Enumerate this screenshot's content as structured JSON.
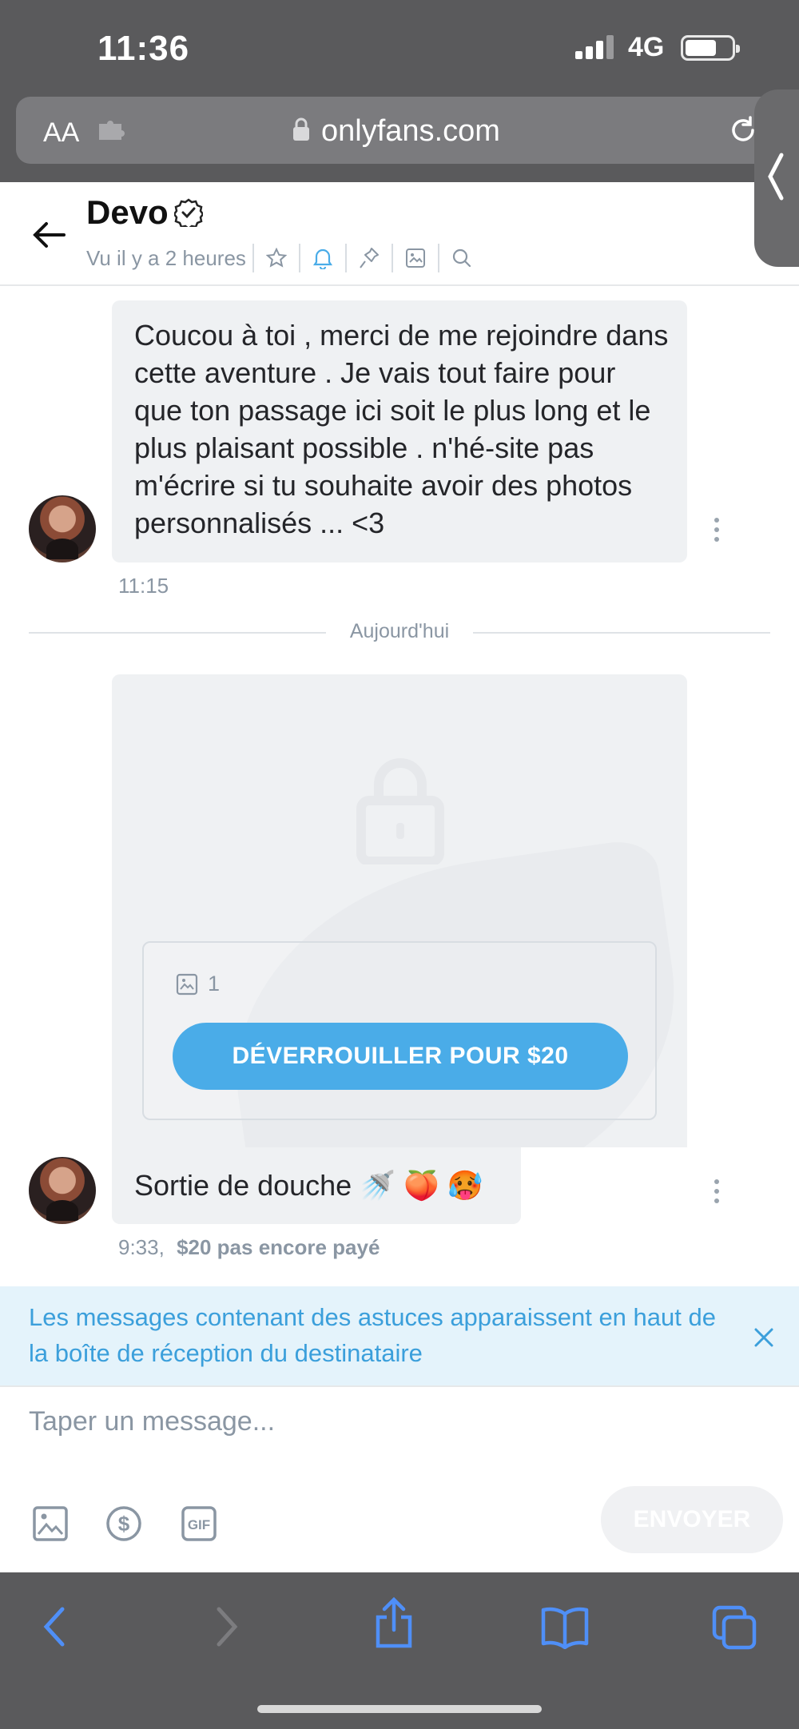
{
  "status_bar": {
    "time": "11:36",
    "network": "4G"
  },
  "browser": {
    "text_size_label": "AA",
    "domain": "onlyfans.com"
  },
  "chat_header": {
    "name": "Devo",
    "last_seen": "Vu il y a 2 heures"
  },
  "messages": [
    {
      "text": "Coucou à toi , merci de me rejoindre dans cette aventure . Je vais tout faire pour que ton passage ici soit le plus long et le plus plaisant possible . n'hé-site pas m'écrire si tu souhaite avoir des photos personnalisés ... <3",
      "time": "11:15"
    }
  ],
  "day_divider": "Aujourd'hui",
  "locked_message": {
    "media_count": "1",
    "unlock_label": "DÉVERROUILLER POUR $20",
    "caption": "Sortie de douche",
    "caption_emojis": [
      "🚿",
      "🍑",
      "🥵"
    ],
    "time": "9:33,",
    "payment_status": "$20 pas encore payé"
  },
  "tips_banner": {
    "text": "Les messages contenant des astuces apparaissent en haut de la boîte de réception du destinataire"
  },
  "composer": {
    "placeholder": "Taper un message...",
    "send_label": "ENVOYER"
  },
  "colors": {
    "accent": "#4aace8",
    "tips_text": "#3b9fdb",
    "tips_bg": "#e4f3fb",
    "bubble": "#eff1f3",
    "chrome": "#5a5a5c"
  },
  "icons": {
    "header": [
      "star-icon",
      "bell-icon",
      "pin-icon",
      "image-icon",
      "search-icon"
    ],
    "composer": [
      "image-icon",
      "dollar-icon",
      "gif-icon"
    ],
    "safari_toolbar": [
      "back-icon",
      "forward-icon",
      "share-icon",
      "bookmarks-icon",
      "tabs-icon"
    ]
  }
}
